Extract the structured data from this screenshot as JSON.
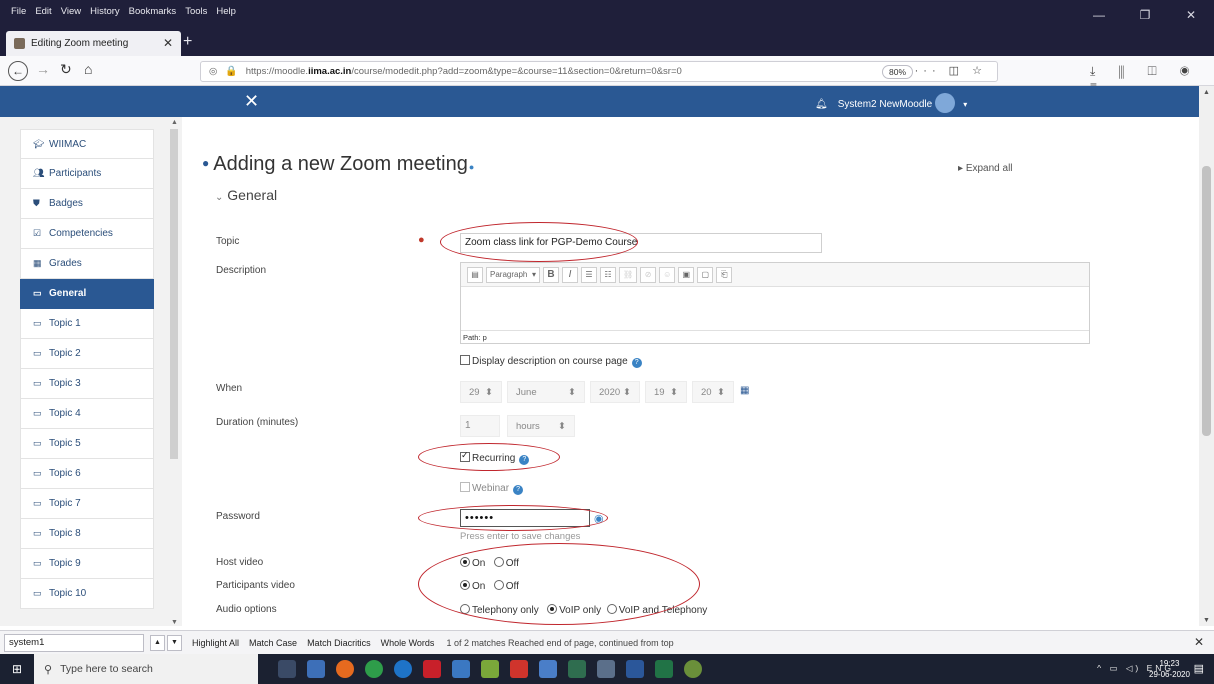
{
  "browser": {
    "menus": [
      "File",
      "Edit",
      "View",
      "History",
      "Bookmarks",
      "Tools",
      "Help"
    ],
    "tab_title": "Editing Zoom meeting",
    "url_prefix": "https://moodle.",
    "url_domain": "iima.ac.in",
    "url_path": "/course/modedit.php?add=zoom&type=&course=11&section=0&return=0&sr=0",
    "zoom_level": "80%"
  },
  "header": {
    "user_name": "System2 NewMoodle"
  },
  "sidebar": {
    "items": [
      {
        "label": "WIIMAC",
        "icon": "graduation-cap-icon"
      },
      {
        "label": "Participants",
        "icon": "users-icon"
      },
      {
        "label": "Badges",
        "icon": "shield-icon"
      },
      {
        "label": "Competencies",
        "icon": "check-square-icon"
      },
      {
        "label": "Grades",
        "icon": "table-icon"
      },
      {
        "label": "General",
        "icon": "folder-icon"
      },
      {
        "label": "Topic 1",
        "icon": "folder-icon"
      },
      {
        "label": "Topic 2",
        "icon": "folder-icon"
      },
      {
        "label": "Topic 3",
        "icon": "folder-icon"
      },
      {
        "label": "Topic 4",
        "icon": "folder-icon"
      },
      {
        "label": "Topic 5",
        "icon": "folder-icon"
      },
      {
        "label": "Topic 6",
        "icon": "folder-icon"
      },
      {
        "label": "Topic 7",
        "icon": "folder-icon"
      },
      {
        "label": "Topic 8",
        "icon": "folder-icon"
      },
      {
        "label": "Topic 9",
        "icon": "folder-icon"
      },
      {
        "label": "Topic 10",
        "icon": "folder-icon"
      }
    ]
  },
  "page": {
    "title": "Adding a new Zoom meeting",
    "expand_all": "Expand all",
    "section": "General"
  },
  "form": {
    "topic_label": "Topic",
    "topic_value": "Zoom class link for PGP-Demo Course",
    "description_label": "Description",
    "editor_paragraph": "Paragraph",
    "editor_path": "Path: p",
    "display_description": "Display description on course page",
    "when_label": "When",
    "when_day": "29",
    "when_month": "June",
    "when_year": "2020",
    "when_hour": "19",
    "when_minute": "20",
    "duration_label": "Duration (minutes)",
    "duration_value": "1",
    "duration_unit": "hours",
    "recurring": "Recurring",
    "webinar": "Webinar",
    "password_label": "Password",
    "password_value": "••••••",
    "password_hint": "Press enter to save changes",
    "host_video_label": "Host video",
    "participants_video_label": "Participants video",
    "on": "On",
    "off": "Off",
    "audio_label": "Audio options",
    "audio_telephony": "Telephony only",
    "audio_voip": "VoIP only",
    "audio_both": "VoIP and Telephony"
  },
  "findbar": {
    "query": "system1",
    "highlight_all": "Highlight All",
    "match_case": "Match Case",
    "match_diacritics": "Match Diacritics",
    "whole_words": "Whole Words",
    "status": "1 of 2 matches   Reached end of page, continued from top"
  },
  "taskbar": {
    "search_placeholder": "Type here to search",
    "tray_lang": "ENG",
    "time": "19:23",
    "date": "29-06-2020"
  },
  "colors": {
    "moodle_blue": "#2a5893",
    "annotation_red": "#c0262d"
  }
}
